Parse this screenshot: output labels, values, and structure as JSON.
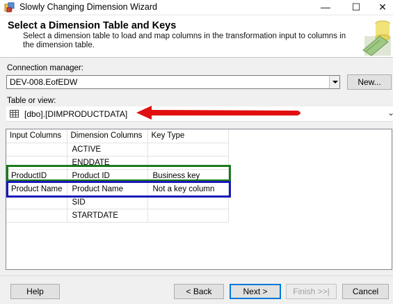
{
  "window": {
    "title": "Slowly Changing Dimension Wizard",
    "controls": {
      "minimize": "—",
      "maximize": "☐",
      "close": "✕"
    }
  },
  "header": {
    "title": "Select a Dimension Table and Keys",
    "description": "Select a dimension table to load and map columns in the transformation input to columns in the dimension table."
  },
  "connection": {
    "label": "Connection manager:",
    "value": "DEV-008.EofEDW",
    "new_button": "New..."
  },
  "table_or_view": {
    "label": "Table or view:",
    "value": "[dbo].[DIMPRODUCTDATA]",
    "icon": "table-icon"
  },
  "grid": {
    "headers": [
      "Input Columns",
      "Dimension Columns",
      "Key Type"
    ],
    "rows": [
      [
        "",
        "ACTIVE",
        ""
      ],
      [
        "",
        "ENDDATE",
        ""
      ],
      [
        "ProductID",
        "Product ID",
        "Business key"
      ],
      [
        "Product Name",
        "Product Name",
        "Not a key column"
      ],
      [
        "",
        "SID",
        ""
      ],
      [
        "",
        "STARTDATE",
        ""
      ]
    ]
  },
  "footer": {
    "help": "Help",
    "back": "< Back",
    "next": "Next >",
    "finish": "Finish >>|",
    "cancel": "Cancel"
  },
  "colors": {
    "highlight_business_key": "#1a7a1a",
    "highlight_not_key": "#1a1ab8",
    "annotation_arrow": "#e01010",
    "accent": "#0078d7"
  }
}
